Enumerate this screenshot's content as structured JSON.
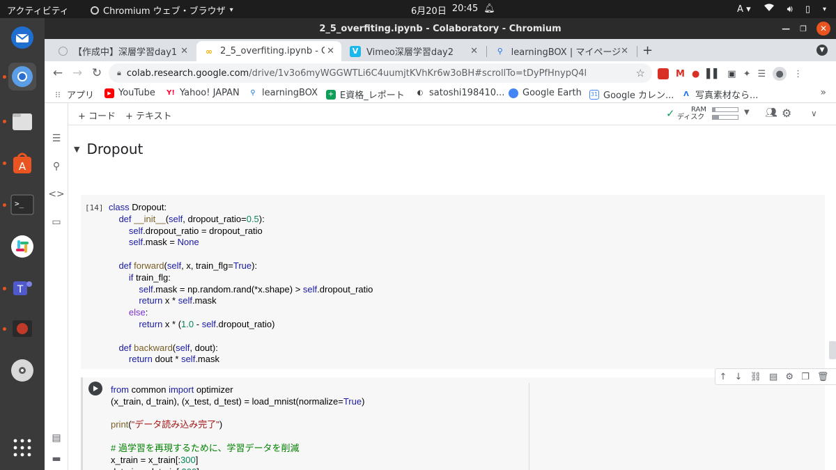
{
  "system_bar": {
    "activities": "アクティビティ",
    "app_name": "Chromium ウェブ・ブラウザ",
    "clock_date": "6月20日",
    "clock_time": "20:45",
    "input_method": "A"
  },
  "dock": {
    "items": [
      {
        "name": "thunderbird-icon",
        "color": "#1f6fd1"
      },
      {
        "name": "chromium-icon",
        "color": "#3f8ee8"
      },
      {
        "name": "files-icon",
        "color": "#e7e7e7"
      },
      {
        "name": "app-center-icon",
        "color": "#e95420"
      },
      {
        "name": "terminal-icon",
        "color": "#2c2c2c"
      },
      {
        "name": "slack-icon",
        "color": "#ffffff"
      },
      {
        "name": "teams-icon",
        "color": "#5059c9"
      },
      {
        "name": "screen-recorder-icon",
        "color": "#c0392b"
      },
      {
        "name": "disc-icon",
        "color": "#d8d8d8"
      },
      {
        "name": "show-apps-icon",
        "color": "#ffffff"
      }
    ]
  },
  "window": {
    "title": "2_5_overfiting.ipynb - Colaboratory - Chromium"
  },
  "tabs": [
    {
      "label": "【作成中】深層学習day1,",
      "active": false
    },
    {
      "label": "2_5_overfiting.ipynb - Col",
      "active": true
    },
    {
      "label": "Vimeo深層学習day2",
      "active": false
    },
    {
      "label": "learningBOX | マイページ",
      "active": false
    }
  ],
  "omnibox": {
    "host": "colab.research.google.com",
    "path": "/drive/1v3o6myWGGWTLi6C4uumjtKVhKr6w3oBH#scrollTo=tDyPfHnypQ4l"
  },
  "bookmarks": [
    {
      "label": "アプリ"
    },
    {
      "label": "YouTube"
    },
    {
      "label": "Yahoo! JAPAN"
    },
    {
      "label": "learningBOX"
    },
    {
      "label": "E資格_レポート"
    },
    {
      "label": "satoshi198410..."
    },
    {
      "label": "Google Earth"
    },
    {
      "label": "Google カレン..."
    },
    {
      "label": "写真素材なら..."
    }
  ],
  "colab": {
    "add_code": "+ コード",
    "add_text": "+ テキスト",
    "ram_label": "RAM",
    "disk_label": "ディスク",
    "ram_usage": 0.1,
    "disk_usage": 0.25,
    "section_title": "Dropout",
    "cell1_exec": "[14]",
    "accent": "#1a73e8"
  },
  "colors": {
    "keyword": "#1a1aa6",
    "number": "#098658",
    "string": "#a31515",
    "comment": "#008000"
  }
}
